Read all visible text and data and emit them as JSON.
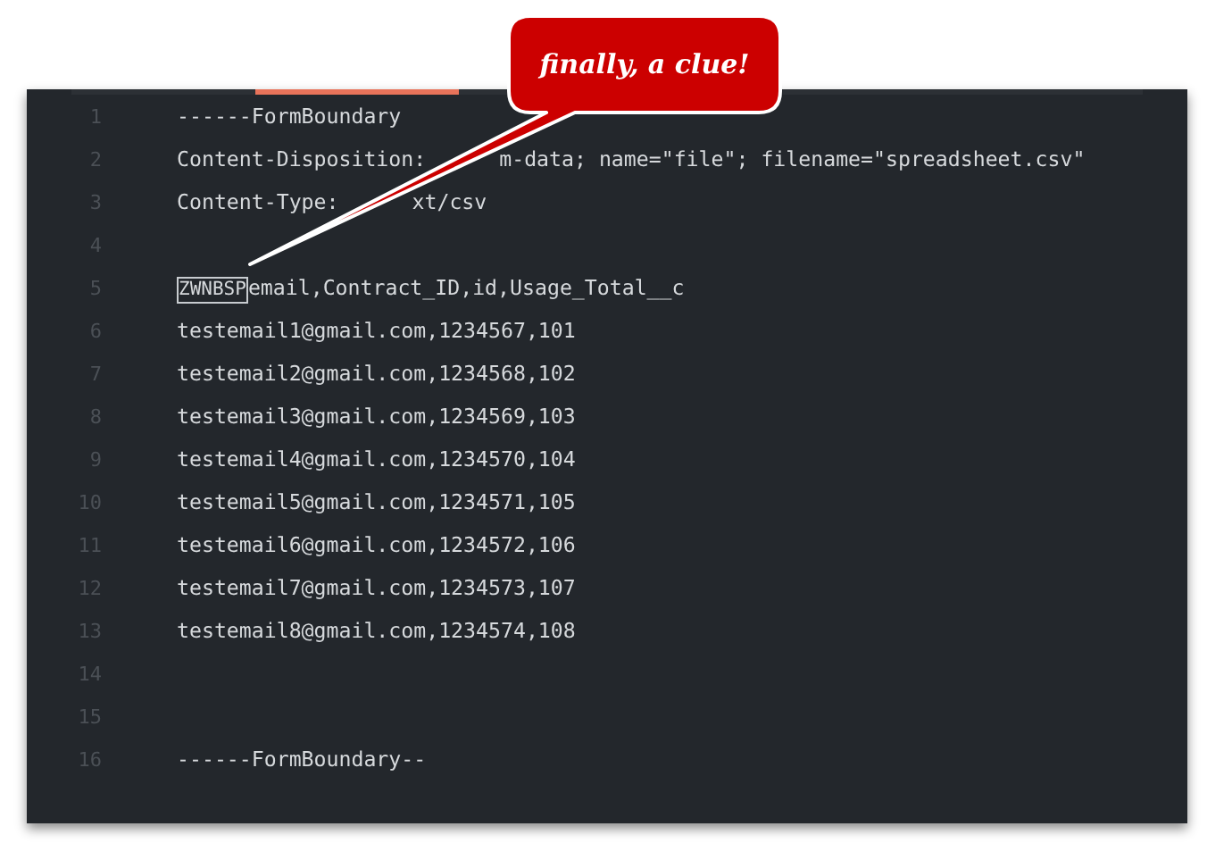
{
  "editor": {
    "lines": [
      {
        "number": "1",
        "text": "------FormBoundary"
      },
      {
        "number": "2",
        "segments": [
          "Content-Disposition:",
          "m-data; name=\"file\"; filename=\"spreadsheet.csv\""
        ]
      },
      {
        "number": "3",
        "segments": [
          "Content-Type:",
          "xt/csv"
        ]
      },
      {
        "number": "4"
      },
      {
        "number": "5",
        "boxed_prefix": "ZWNBSP",
        "text": "email,Contract_ID,id,Usage_Total__c"
      },
      {
        "number": "6",
        "text": "testemail1@gmail.com,1234567,101"
      },
      {
        "number": "7",
        "text": "testemail2@gmail.com,1234568,102"
      },
      {
        "number": "8",
        "text": "testemail3@gmail.com,1234569,103"
      },
      {
        "number": "9",
        "text": "testemail4@gmail.com,1234570,104"
      },
      {
        "number": "10",
        "text": "testemail5@gmail.com,1234571,105"
      },
      {
        "number": "11",
        "text": "testemail6@gmail.com,1234572,106"
      },
      {
        "number": "12",
        "text": "testemail7@gmail.com,1234573,107"
      },
      {
        "number": "13",
        "text": "testemail8@gmail.com,1234574,108"
      },
      {
        "number": "14"
      },
      {
        "number": "15"
      },
      {
        "number": "16",
        "text": "------FormBoundary--"
      }
    ]
  },
  "callout": {
    "text": "finally, a clue!"
  }
}
